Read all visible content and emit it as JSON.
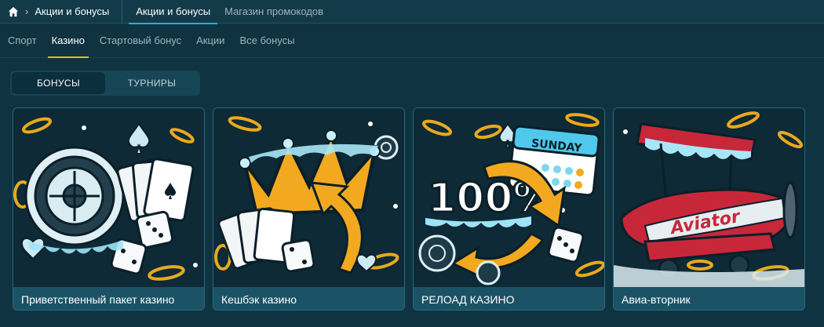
{
  "breadcrumb": {
    "home_icon": "home-icon",
    "chevron_icon": "chevron-right-icon",
    "label": "Акции и бонусы"
  },
  "top_tabs": [
    {
      "label": "Акции и бонусы",
      "active": true
    },
    {
      "label": "Магазин промокодов",
      "active": false
    }
  ],
  "sub_tabs": [
    {
      "label": "Спорт",
      "active": false
    },
    {
      "label": "Казино",
      "active": true
    },
    {
      "label": "Стартовый бонус",
      "active": false
    },
    {
      "label": "Акции",
      "active": false
    },
    {
      "label": "Все бонусы",
      "active": false
    }
  ],
  "segment": {
    "items": [
      {
        "label": "БОНУСЫ",
        "active": true
      },
      {
        "label": "ТУРНИРЫ",
        "active": false
      }
    ]
  },
  "cards": [
    {
      "title": "Приветственный пакет казино",
      "image": "roulette-cards-dice-illustration"
    },
    {
      "title": "Кешбэк казино",
      "image": "crown-cashback-illustration",
      "art": {
        "accent": "#f3a91f"
      }
    },
    {
      "title": "РЕЛОАД КАЗИНО",
      "image": "reload-100-percent-illustration",
      "art": {
        "headline": "100%",
        "calendar_label": "SUNDAY"
      }
    },
    {
      "title": "Авиа-вторник",
      "image": "aviator-plane-illustration",
      "art": {
        "logo_text": "Aviator"
      }
    }
  ],
  "colors": {
    "accent_blue": "#1fb3d6",
    "accent_gold": "#f6b32a",
    "background": "#0f3340"
  }
}
